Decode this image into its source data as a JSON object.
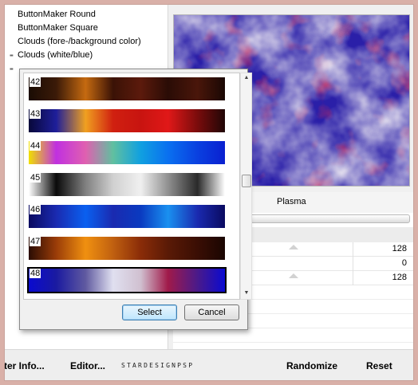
{
  "filter_list": {
    "items": [
      {
        "label": "ButtonMaker Round",
        "grip": false
      },
      {
        "label": "ButtonMaker Square",
        "grip": false
      },
      {
        "label": "Clouds (fore-/background color)",
        "grip": false
      },
      {
        "label": "Clouds (white/blue)",
        "grip": true
      }
    ]
  },
  "preview": {
    "colors": {
      "base": "#2a1fa8",
      "cloud": "#eceaf4",
      "accent": "#b02a6a"
    }
  },
  "parameters": {
    "title": "Plasma",
    "values": [
      "128",
      "0",
      "128"
    ]
  },
  "bottom_bar": {
    "filter_info": "ter Info...",
    "editor": "Editor...",
    "brand": "STARDESIGNPSP",
    "randomize": "Randomize",
    "reset": "Reset"
  },
  "gradient_picker": {
    "swatches": [
      {
        "number": "42",
        "stops": [
          "#1a0c04",
          "#3b1a08",
          "#c56a10",
          "#3a1206",
          "#5c1a0c",
          "#2a0c06",
          "#4a160a",
          "#1a0804"
        ]
      },
      {
        "number": "43",
        "stops": [
          "#08083a",
          "#1e1e9a",
          "#f0a020",
          "#d02010",
          "#c81410",
          "#e01818",
          "#7a0c0c",
          "#200606"
        ]
      },
      {
        "number": "44",
        "stops": [
          "#f0e000",
          "#c030e0",
          "#e060b0",
          "#60c0a0",
          "#10a0e0",
          "#0a70f0",
          "#0a40e0",
          "#0a20d0"
        ]
      },
      {
        "number": "45",
        "stops": [
          "#ffffff",
          "#0a0a0a",
          "#808080",
          "#d0d0d0",
          "#f0f0f0",
          "#909090",
          "#2a2a2a",
          "#ffffff"
        ]
      },
      {
        "number": "46",
        "stops": [
          "#0a0a60",
          "#1a2ab0",
          "#0a60f0",
          "#1a2ab0",
          "#0a3ac0",
          "#1a90f0",
          "#1a2ab0",
          "#0a0a60"
        ]
      },
      {
        "number": "47",
        "stops": [
          "#2a0c04",
          "#9a3c08",
          "#f09010",
          "#c06010",
          "#8a2c08",
          "#5a1a06",
          "#3a0e04",
          "#1a0602"
        ]
      },
      {
        "number": "48",
        "stops": [
          "#0a0ad0",
          "#1a1aa0",
          "#605aa0",
          "#e0e0f0",
          "#d0c0d0",
          "#a01a4a",
          "#4a1a8a",
          "#0a0ad0"
        ]
      }
    ],
    "select_label": "Select",
    "cancel_label": "Cancel"
  }
}
